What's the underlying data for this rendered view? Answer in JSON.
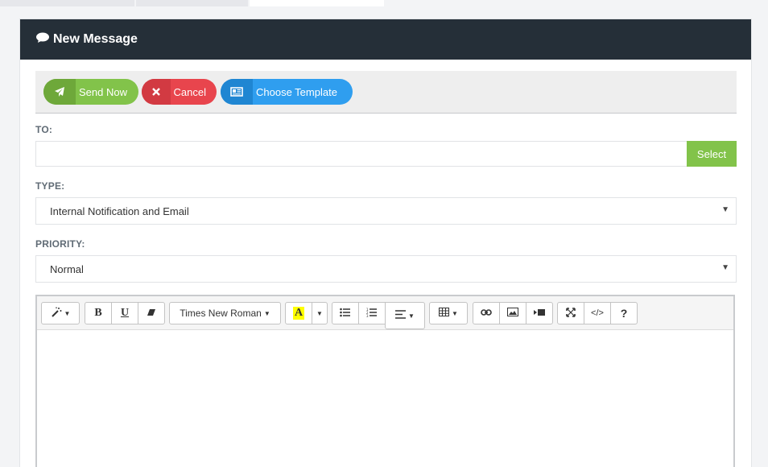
{
  "header": {
    "title": "New Message",
    "icon": "comment-icon"
  },
  "actions": {
    "send_label": "Send Now",
    "cancel_label": "Cancel",
    "template_label": "Choose Template"
  },
  "form": {
    "to_label": "TO:",
    "to_value": "",
    "select_label": "Select",
    "type_label": "TYPE:",
    "type_value": "Internal Notification and Email",
    "priority_label": "PRIORITY:",
    "priority_value": "Normal"
  },
  "editor": {
    "font_name": "Times New Roman",
    "bold": "B",
    "underline": "U",
    "code": "</>",
    "help": "?",
    "highlight": "A"
  },
  "colors": {
    "header_bg": "#252f38",
    "send_green": "#82c34a",
    "cancel_red": "#e8454d",
    "template_blue": "#2f9eef"
  }
}
